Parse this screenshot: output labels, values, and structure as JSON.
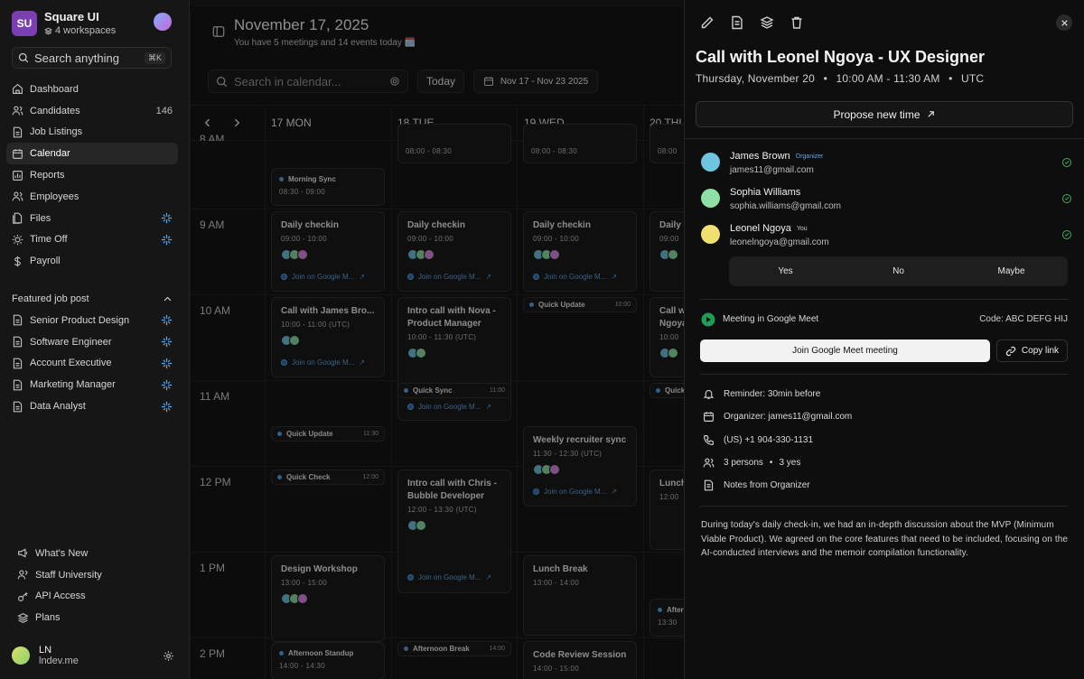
{
  "workspace": {
    "logo": "SU",
    "name": "Square UI",
    "sub": "4 workspaces"
  },
  "search": {
    "placeholder": "Search anything",
    "shortcut": "⌘K"
  },
  "nav": {
    "items": [
      {
        "label": "Dashboard",
        "icon": "home-icon"
      },
      {
        "label": "Candidates",
        "icon": "users-icon",
        "count": "146"
      },
      {
        "label": "Job Listings",
        "icon": "file-icon"
      },
      {
        "label": "Calendar",
        "icon": "calendar-icon",
        "active": true
      },
      {
        "label": "Reports",
        "icon": "chart-icon"
      },
      {
        "label": "Employees",
        "icon": "users-icon"
      },
      {
        "label": "Files",
        "icon": "folder-icon",
        "sparkle": true
      },
      {
        "label": "Time Off",
        "icon": "sun-icon",
        "sparkle": true
      },
      {
        "label": "Payroll",
        "icon": "dollar-icon"
      }
    ]
  },
  "featured": {
    "title": "Featured job post",
    "items": [
      "Senior Product Design",
      "Software Engineer",
      "Account Executive",
      "Marketing Manager",
      "Data Analyst"
    ]
  },
  "bottom_nav": [
    "What's New",
    "Staff University",
    "API Access",
    "Plans"
  ],
  "user": {
    "initials": "LN",
    "name": "LN",
    "sub": "lndev.me"
  },
  "header": {
    "date": "November 17, 2025",
    "summary": "You have 5 meetings and 14 events today 🗓️"
  },
  "toolbar": {
    "search_placeholder": "Search in calendar...",
    "today": "Today",
    "range": "Nov 17 - Nov 23 2025"
  },
  "days": [
    "17 MON",
    "18 TUE",
    "19 WED",
    "20 THU"
  ],
  "hours": [
    "8 AM",
    "9 AM",
    "10 AM",
    "11 AM",
    "12 PM",
    "1 PM",
    "2 PM"
  ],
  "events": {
    "mon": {
      "morning_sync": {
        "title": "Morning Sync",
        "time": "08:30 - 09:00"
      },
      "daily": {
        "title": "Daily checkin",
        "time": "09:00 - 10:00",
        "link": "Join on Google M..."
      },
      "call_james": {
        "title": "Call with James Bro...",
        "time": "10:00 - 11:00 (UTC)",
        "link": "Join on Google M..."
      },
      "quick_update": {
        "title": "Quick Update",
        "time": "11:30"
      },
      "quick_check": {
        "title": "Quick Check",
        "time": "12:00"
      },
      "design_workshop": {
        "title": "Design Workshop",
        "time": "13:00 - 15:00"
      },
      "afternoon_standup": {
        "title": "Afternoon Standup",
        "time": "14:00 - 14:30"
      }
    },
    "tue": {
      "top": {
        "time": "08:00 - 08:30"
      },
      "daily": {
        "title": "Daily checkin",
        "time": "09:00 - 10:00",
        "link": "Join on Google M..."
      },
      "intro_nova": {
        "title": "Intro call with Nova - Product Manager",
        "time": "10:00 - 11:30 (UTC)"
      },
      "quick_sync": {
        "title": "Quick Sync",
        "time": "11:00",
        "link": "Join on Google M..."
      },
      "intro_chris": {
        "title": "Intro call with Chris - Bubble Developer",
        "time": "12:00 - 13:30 (UTC)",
        "link": "Join on Google M..."
      },
      "afternoon_break": {
        "title": "Afternoon Break",
        "time": "14:00"
      }
    },
    "wed": {
      "top": {
        "time": "08:00 - 08:30"
      },
      "daily": {
        "title": "Daily checkin",
        "time": "09:00 - 10:00",
        "link": "Join on Google M..."
      },
      "quick_update": {
        "title": "Quick Update",
        "time": "10:00"
      },
      "weekly": {
        "title": "Weekly recruiter sync",
        "time": "11:30 - 12:30 (UTC)",
        "link": "Join on Google M..."
      },
      "lunch": {
        "title": "Lunch Break",
        "time": "13:00 - 14:00"
      },
      "code_review": {
        "title": "Code Review Session",
        "time": "14:00 - 15:00"
      }
    },
    "thu": {
      "top": {
        "time": "08:00"
      },
      "daily": {
        "title": "Daily c",
        "time": "09:00"
      },
      "call": {
        "title": "Call w Ngoya",
        "time": "10:00"
      },
      "quick": {
        "title": "Quick"
      },
      "lunch": {
        "title": "Lunch",
        "time": "12:00"
      },
      "after": {
        "title": "After",
        "time": "13:30"
      }
    }
  },
  "panel": {
    "title": "Call with Leonel Ngoya - UX Designer",
    "date_day": "Thursday, November 20",
    "date_time": "10:00 AM - 11:30 AM",
    "date_tz": "UTC",
    "propose": "Propose new time",
    "attendees": [
      {
        "name": "James Brown",
        "tag": "Organizer",
        "email": "james11@gmail.com",
        "color": "#6fc4e0"
      },
      {
        "name": "Sophia Williams",
        "tag": "",
        "email": "sophia.williams@gmail.com",
        "color": "#8ee0a6"
      },
      {
        "name": "Leonel Ngoya",
        "tag": "You",
        "email": "leonelngoya@gmail.com",
        "color": "#f0e070"
      }
    ],
    "rsvp": [
      "Yes",
      "No",
      "Maybe"
    ],
    "meet_label": "Meeting in Google Meet",
    "meet_code": "Code: ABC DEFG HIJ",
    "join": "Join Google Meet meeting",
    "copy": "Copy link",
    "reminder": "Reminder: 30min before",
    "organizer": "Organizer: james11@gmail.com",
    "phone": "(US) +1 904-330-1131",
    "persons": "3 persons",
    "yes_count": "3 yes",
    "notes_label": "Notes from Organizer",
    "notes": "During today's daily check-in, we had an in-depth discussion about the MVP (Minimum Viable Product). We agreed on the core features that need to be included, focusing on the AI-conducted interviews and the memoir compilation functionality."
  }
}
